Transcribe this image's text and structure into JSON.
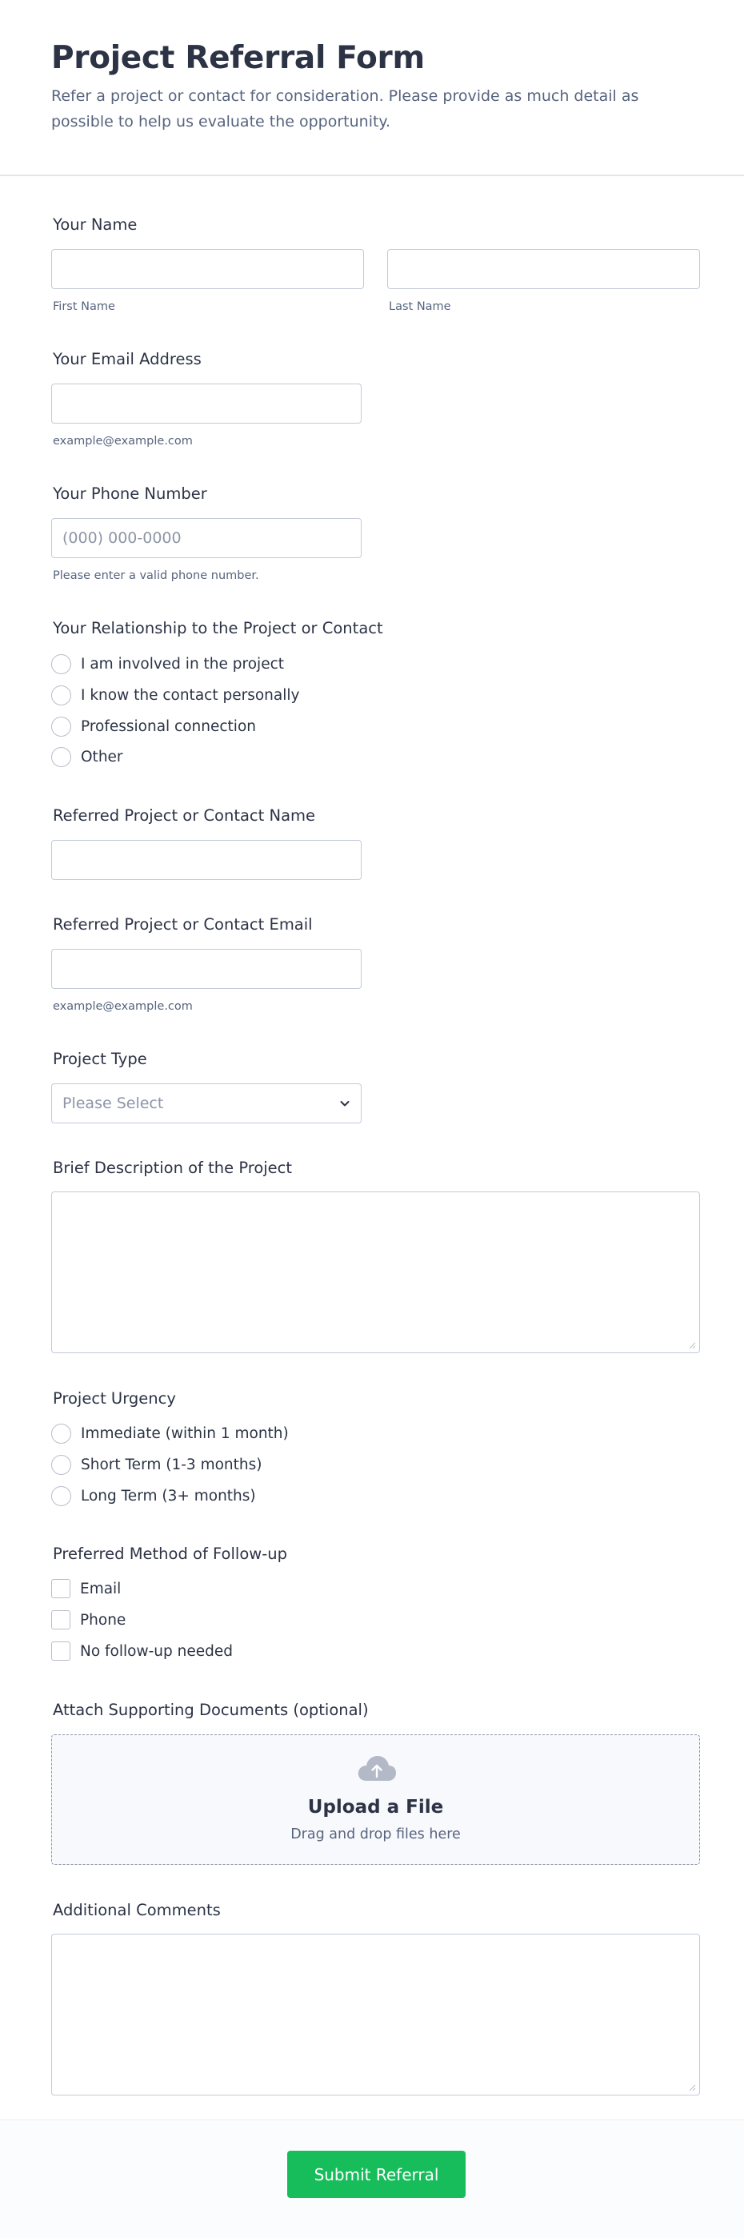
{
  "header": {
    "title": "Project Referral Form",
    "subtitle": "Refer a project or contact for consideration. Please provide as much detail as possible to help us evaluate the opportunity."
  },
  "fields": {
    "name": {
      "label": "Your Name",
      "first_sublabel": "First Name",
      "last_sublabel": "Last Name",
      "first_value": "",
      "last_value": ""
    },
    "email": {
      "label": "Your Email Address",
      "sublabel": "example@example.com",
      "value": ""
    },
    "phone": {
      "label": "Your Phone Number",
      "placeholder": "(000) 000-0000",
      "sublabel": "Please enter a valid phone number."
    },
    "relationship": {
      "label": "Your Relationship to the Project or Contact",
      "options": [
        "I am involved in the project",
        "I know the contact personally",
        "Professional connection",
        "Other"
      ]
    },
    "referred_name": {
      "label": "Referred Project or Contact Name",
      "value": ""
    },
    "referred_email": {
      "label": "Referred Project or Contact Email",
      "sublabel": "example@example.com",
      "value": ""
    },
    "project_type": {
      "label": "Project Type",
      "selected": "Please Select",
      "icon": "chevron-down-icon"
    },
    "description": {
      "label": "Brief Description of the Project",
      "value": ""
    },
    "urgency": {
      "label": "Project Urgency",
      "options": [
        "Immediate (within 1 month)",
        "Short Term (1-3 months)",
        "Long Term (3+ months)"
      ]
    },
    "followup": {
      "label": "Preferred Method of Follow-up",
      "options": [
        "Email",
        "Phone",
        "No follow-up needed"
      ]
    },
    "attachments": {
      "label": "Attach Supporting Documents (optional)",
      "upload_title": "Upload a File",
      "upload_subtitle": "Drag and drop files here",
      "icon": "cloud-upload-icon"
    },
    "comments": {
      "label": "Additional Comments",
      "value": ""
    }
  },
  "footer": {
    "submit_label": "Submit Referral"
  },
  "colors": {
    "submit": "#18bd5b",
    "text": "#2c3345",
    "muted": "#57647e",
    "border": "#c3cad8"
  }
}
